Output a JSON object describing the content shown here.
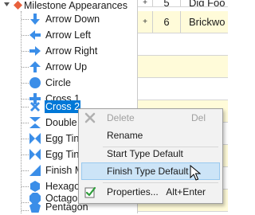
{
  "tree": {
    "root": {
      "label": "Milestone Appearances",
      "icon": "diamond-icon",
      "color": "#e8603c"
    },
    "items": [
      {
        "label": "Arrow Down",
        "icon": "arrow-down-icon"
      },
      {
        "label": "Arrow Left",
        "icon": "arrow-left-icon"
      },
      {
        "label": "Arrow Right",
        "icon": "arrow-right-icon"
      },
      {
        "label": "Arrow Up",
        "icon": "arrow-up-icon"
      },
      {
        "label": "Circle",
        "icon": "circle-icon"
      },
      {
        "label": "Cross 1",
        "icon": "cross-1-icon"
      },
      {
        "label": "Cross 2",
        "icon": "cross-2-icon",
        "selected": true
      },
      {
        "label": "Double",
        "icon": "double-triangle-icon"
      },
      {
        "label": "Egg Tin",
        "icon": "egg-timer-icon"
      },
      {
        "label": "Egg Tin",
        "icon": "egg-timer-icon"
      },
      {
        "label": "Finish M",
        "icon": "finish-milestone-icon"
      },
      {
        "label": "Hexago",
        "icon": "hexagon-icon"
      },
      {
        "label": "Octagon",
        "icon": "octagon-icon"
      },
      {
        "label": "Pentagon",
        "icon": "pentagon-icon"
      }
    ],
    "shape_color": "#3b8ee8"
  },
  "grid": {
    "rows": [
      {
        "expand": "+",
        "num": "5",
        "text": "Dig Foo"
      },
      {
        "expand": "+",
        "num": "6",
        "text": "Brickwo"
      },
      {
        "expand": "",
        "num": "",
        "text": ""
      },
      {
        "expand": "",
        "num": "",
        "text": ""
      },
      {
        "expand": "",
        "num": "",
        "text": ""
      },
      {
        "expand": "",
        "num": "",
        "text": ""
      },
      {
        "expand": "",
        "num": "",
        "text": ""
      },
      {
        "expand": "",
        "num": "",
        "text": ""
      },
      {
        "expand": "",
        "num": "",
        "text": ""
      },
      {
        "expand": "",
        "num": "",
        "text": ""
      }
    ],
    "highlight_color": "#fffbd9"
  },
  "context_menu": {
    "delete": {
      "label": "Delete",
      "shortcut": "Del",
      "icon": "delete-x-icon",
      "enabled": false
    },
    "rename": {
      "label": "Rename"
    },
    "start_type_default": {
      "label": "Start Type Default"
    },
    "finish_type_default": {
      "label": "Finish Type Default",
      "hovered": true
    },
    "properties": {
      "label": "Properties...",
      "shortcut": "Alt+Enter",
      "icon": "properties-check-icon"
    }
  }
}
